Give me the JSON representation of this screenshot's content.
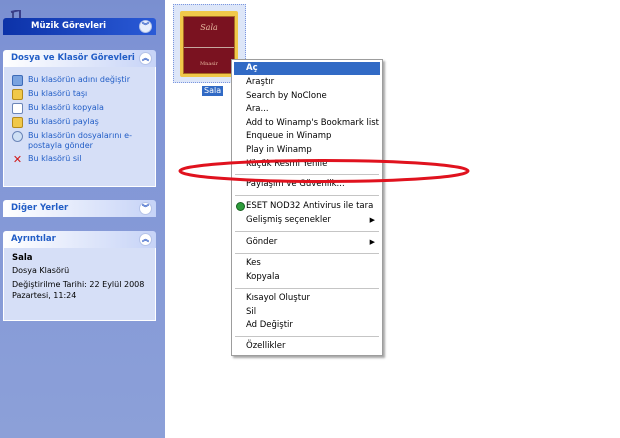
{
  "task_pane": {
    "music_panel": {
      "title": "Müzik Görevleri"
    },
    "folder_tasks": {
      "title": "Dosya ve Klasör Görevleri",
      "items": [
        {
          "label": "Bu klasörün adını değiştir",
          "icon": "rename-icon"
        },
        {
          "label": "Bu klasörü taşı",
          "icon": "move-icon"
        },
        {
          "label": "Bu klasörü kopyala",
          "icon": "copy-icon"
        },
        {
          "label": "Bu klasörü paylaş",
          "icon": "share-icon"
        },
        {
          "label": "Bu klasörün dosyalarını e-postayla gönder",
          "icon": "email-icon"
        },
        {
          "label": "Bu klasörü sil",
          "icon": "delete-icon"
        }
      ]
    },
    "other_places": {
      "title": "Diğer Yerler"
    },
    "details": {
      "title": "Ayrıntılar",
      "name": "Sala",
      "type": "Dosya Klasörü",
      "modified_line1": "Değiştirilme Tarihi: 22 Eylül 2008",
      "modified_line2": "Pazartesi, 11:24"
    }
  },
  "folder": {
    "label": "Sala",
    "art_title": "Sala",
    "art_subtitle": "Mnasir"
  },
  "context_menu": {
    "items": [
      {
        "label": "Aç",
        "selected": true
      },
      {
        "label": "Araştır"
      },
      {
        "label": "Search by NoClone"
      },
      {
        "label": "Ara..."
      },
      {
        "label": "Add to Winamp's Bookmark list"
      },
      {
        "label": "Enqueue in Winamp"
      },
      {
        "label": "Play in Winamp"
      },
      {
        "label": "Küçük Resmi Yenile"
      },
      {
        "label": "Paylaşım ve Güvenlik..."
      },
      {
        "label": "ESET NOD32 Antivirus ile tara",
        "icon": "eset-icon"
      },
      {
        "label": "Gelişmiş seçenekler",
        "submenu": true
      },
      {
        "label": "Gönder",
        "submenu": true
      },
      {
        "label": "Kes"
      },
      {
        "label": "Kopyala"
      },
      {
        "label": "Kısayol Oluştur"
      },
      {
        "label": "Sil"
      },
      {
        "label": "Ad Değiştir"
      },
      {
        "label": "Özellikler"
      }
    ]
  },
  "colors": {
    "selection": "#316ac5",
    "link_blue": "#215dc6",
    "annotation_red": "#e0121e"
  }
}
